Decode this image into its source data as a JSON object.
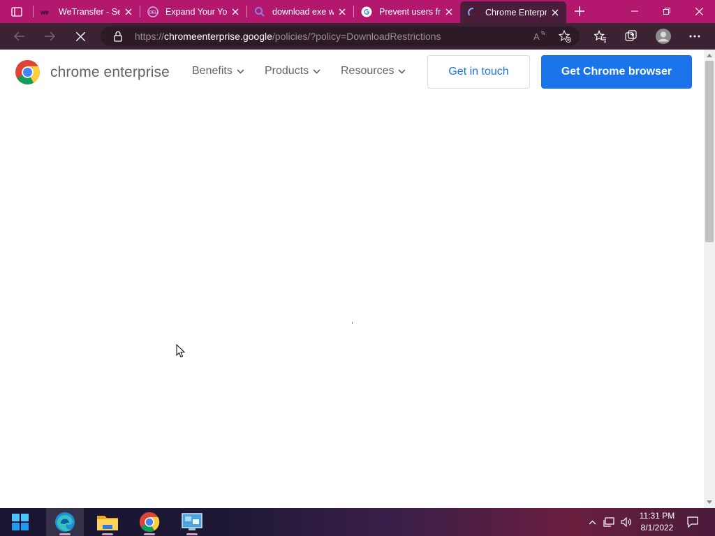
{
  "browser": {
    "tabs": [
      {
        "title": "WeTransfer - Send",
        "icon": "wetransfer-icon",
        "active": false
      },
      {
        "title": "Expand Your Your",
        "icon": "dell-icon",
        "active": false
      },
      {
        "title": "download exe w",
        "icon": "search-icon",
        "active": false
      },
      {
        "title": "Prevent users fro",
        "icon": "google-icon",
        "active": false
      },
      {
        "title": "Chrome Enterprise",
        "icon": "loading-spinner-icon",
        "active": true
      }
    ],
    "url_host": "chromeenterprise.google",
    "url_scheme": "https://",
    "url_path": "/policies/?policy=DownloadRestrictions",
    "colors": {
      "tabstrip": "#b3176e",
      "toolbar": "#3b2334"
    }
  },
  "page": {
    "brand": "chrome enterprise",
    "nav": [
      {
        "label": "Benefits"
      },
      {
        "label": "Products"
      },
      {
        "label": "Resources"
      }
    ],
    "cta_secondary": "Get in touch",
    "cta_primary": "Get Chrome browser",
    "colors": {
      "primary": "#1a73e8",
      "nav_text": "#5f6368"
    }
  },
  "taskbar": {
    "apps": [
      "start-icon",
      "edge-icon",
      "file-explorer-icon",
      "chrome-icon",
      "remote-desktop-icon"
    ],
    "time": "11:31 PM",
    "date": "8/1/2022"
  }
}
